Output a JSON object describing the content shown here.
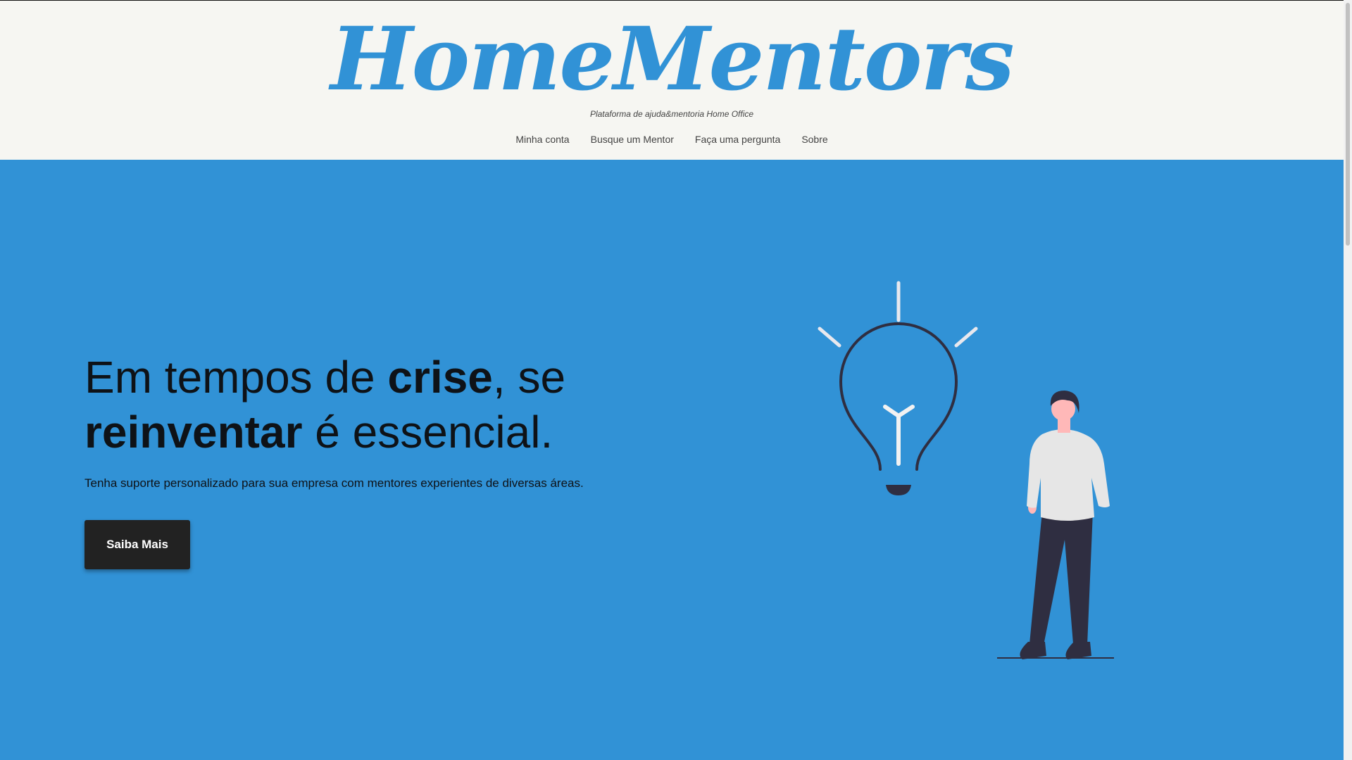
{
  "header": {
    "logo": "HomeMentors",
    "tagline": "Plataforma de ajuda&mentoria Home Office",
    "nav": [
      "Minha conta",
      "Busque um Mentor",
      "Faça uma pergunta",
      "Sobre"
    ]
  },
  "hero": {
    "headline": {
      "part1": "Em tempos de ",
      "bold1": "crise",
      "part2": ", se ",
      "bold2": "reinventar",
      "part3": " é essencial."
    },
    "subtext": "Tenha suporte personalizado para sua empresa com mentores experientes de diversas áreas.",
    "cta_label": "Saiba Mais"
  },
  "colors": {
    "brand_blue": "#3192d6",
    "header_bg": "#f6f6f2",
    "button_bg": "#222222",
    "text_dark": "#0e1217"
  },
  "illustration": {
    "icons": [
      "lightbulb-icon",
      "person-illustration"
    ]
  }
}
